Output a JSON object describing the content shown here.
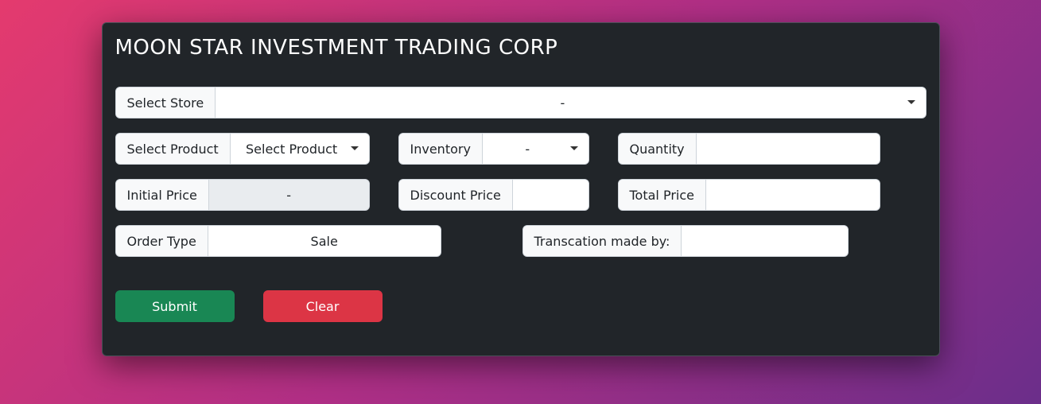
{
  "title": "MOON STAR INVESTMENT TRADING CORP",
  "store": {
    "label": "Select Store",
    "selected": "-"
  },
  "product": {
    "label": "Select Product",
    "selected": "Select Product"
  },
  "inventory": {
    "label": "Inventory",
    "selected": "-"
  },
  "quantity": {
    "label": "Quantity",
    "value": ""
  },
  "initial_price": {
    "label": "Initial Price",
    "value": "-"
  },
  "discount_price": {
    "label": "Discount Price",
    "value": ""
  },
  "total_price": {
    "label": "Total Price",
    "value": ""
  },
  "order_type": {
    "label": "Order Type",
    "value": "Sale"
  },
  "transaction_by": {
    "label": "Transcation made by:",
    "value": ""
  },
  "buttons": {
    "submit": "Submit",
    "clear": "Clear"
  }
}
